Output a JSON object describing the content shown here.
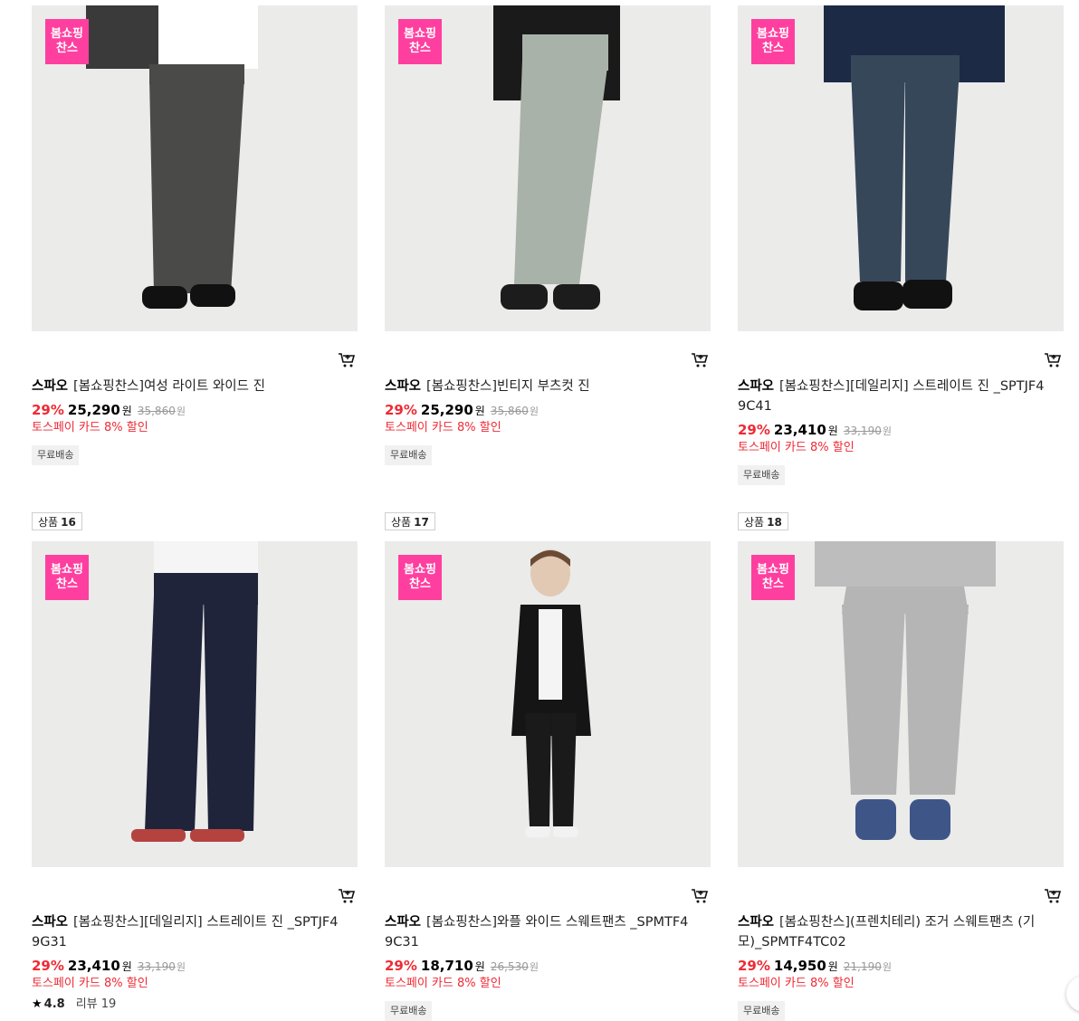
{
  "promo_badge": "봄쇼핑 찬스",
  "currency": "원",
  "products": [
    {
      "brand": "스파오",
      "name": "[봄쇼핑찬스]여성 라이트 와이드 진",
      "discount": "29%",
      "price": "25,290",
      "original_price": "35,860",
      "benefit": "토스페이 카드 8% 할인",
      "tag": "무료배송",
      "top_color": "#3a3a3a",
      "pants_color": "#4a4a48",
      "cart_icon": "cart-icon"
    },
    {
      "brand": "스파오",
      "name": "[봄쇼핑찬스]빈티지 부츠컷 진",
      "discount": "29%",
      "price": "25,290",
      "original_price": "35,860",
      "benefit": "토스페이 카드 8% 할인",
      "tag": "무료배송",
      "top_color": "#1a1a1a",
      "pants_color": "#a9b2a8",
      "cart_icon": "cart-icon"
    },
    {
      "brand": "스파오",
      "name": "[봄쇼핑찬스][데일리지] 스트레이트 진 _SPTJF49C41",
      "discount": "29%",
      "price": "23,410",
      "original_price": "33,190",
      "benefit": "토스페이 카드 8% 할인",
      "tag": "무료배송",
      "top_color": "#1d2a45",
      "pants_color": "#37475a",
      "cart_icon": "cart-icon"
    },
    {
      "rank_label": "상품",
      "rank": "16",
      "brand": "스파오",
      "name": "[봄쇼핑찬스][데일리지] 스트레이트 진 _SPTJF49G31",
      "discount": "29%",
      "price": "23,410",
      "original_price": "33,190",
      "benefit": "토스페이 카드 8% 할인",
      "rating": "4.8",
      "review": "리뷰 19",
      "top_color": "#f5f5f5",
      "pants_color": "#20243a",
      "cart_icon": "cart-icon"
    },
    {
      "rank_label": "상품",
      "rank": "17",
      "brand": "스파오",
      "name": "[봄쇼핑찬스]와플 와이드 스웨트팬츠 _SPMTF49C31",
      "discount": "29%",
      "price": "18,710",
      "original_price": "26,530",
      "benefit": "토스페이 카드 8% 할인",
      "tag": "무료배송",
      "top_color": "#151515",
      "pants_color": "#1a1a1a",
      "cart_icon": "cart-icon"
    },
    {
      "rank_label": "상품",
      "rank": "18",
      "brand": "스파오",
      "name": "[봄쇼핑찬스](프렌치테리) 조거 스웨트팬츠 (기모)_SPMTF4TC02",
      "discount": "29%",
      "price": "14,950",
      "original_price": "21,190",
      "benefit": "토스페이 카드 8% 할인",
      "tag": "무료배송",
      "top_color": "#bdbdbd",
      "pants_color": "#b5b5b5",
      "cart_icon": "cart-icon"
    }
  ]
}
